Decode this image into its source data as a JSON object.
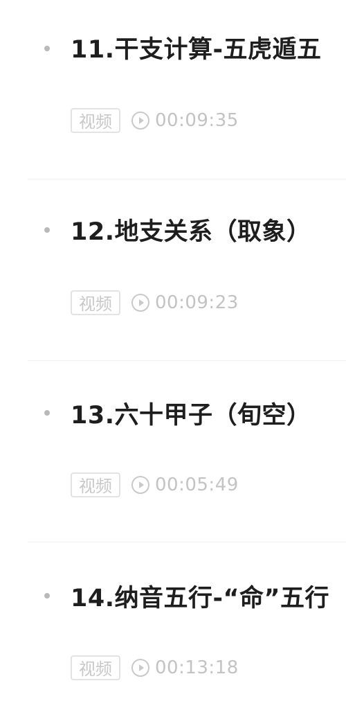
{
  "lessons": [
    {
      "title": "11.干支计算-五虎遁五",
      "tag": "视频",
      "duration": "00:09:35"
    },
    {
      "title": "12.地支关系（取象）",
      "tag": "视频",
      "duration": "00:09:23"
    },
    {
      "title": "13.六十甲子（旬空）",
      "tag": "视频",
      "duration": "00:05:49"
    },
    {
      "title": "14.纳音五行-“命”五行",
      "tag": "视频",
      "duration": "00:13:18"
    }
  ],
  "icons": {
    "bullet": "dot-icon",
    "play": "play-circle-icon"
  },
  "colors": {
    "title": "#1e1e1e",
    "meta": "#c3c3c3",
    "tag_border": "#e3e3e3",
    "bullet": "#b9b9b9"
  }
}
